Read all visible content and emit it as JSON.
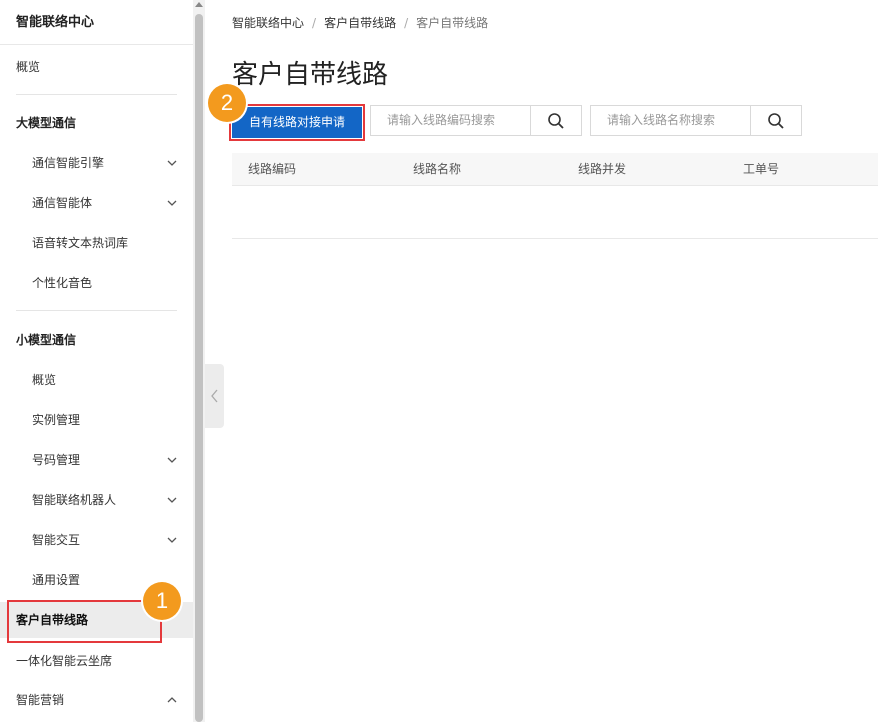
{
  "sidebar": {
    "title": "智能联络中心",
    "overview": "概览",
    "group_large": "大模型通信",
    "large_items": [
      "通信智能引擎",
      "通信智能体",
      "语音转文本热词库",
      "个性化音色"
    ],
    "group_small": "小模型通信",
    "small_items": [
      "概览",
      "实例管理",
      "号码管理",
      "智能联络机器人",
      "智能交互",
      "通用设置"
    ],
    "active_item": "客户自带线路",
    "item_cloud_seat": "一体化智能云坐席",
    "item_marketing": "智能营销"
  },
  "breadcrumb": {
    "items": [
      "智能联络中心",
      "客户自带线路",
      "客户自带线路"
    ],
    "separator": "/"
  },
  "page": {
    "title": "客户自带线路",
    "apply_button": "自有线路对接申请",
    "search_code_placeholder": "请输入线路编码搜索",
    "search_name_placeholder": "请输入线路名称搜索"
  },
  "table": {
    "columns": [
      "线路编码",
      "线路名称",
      "线路并发",
      "工单号"
    ]
  },
  "annotations": {
    "badge1": "1",
    "badge2": "2"
  },
  "colors": {
    "primary": "#1366c6",
    "highlight": "#e4393c",
    "badge": "#f39a1e"
  }
}
